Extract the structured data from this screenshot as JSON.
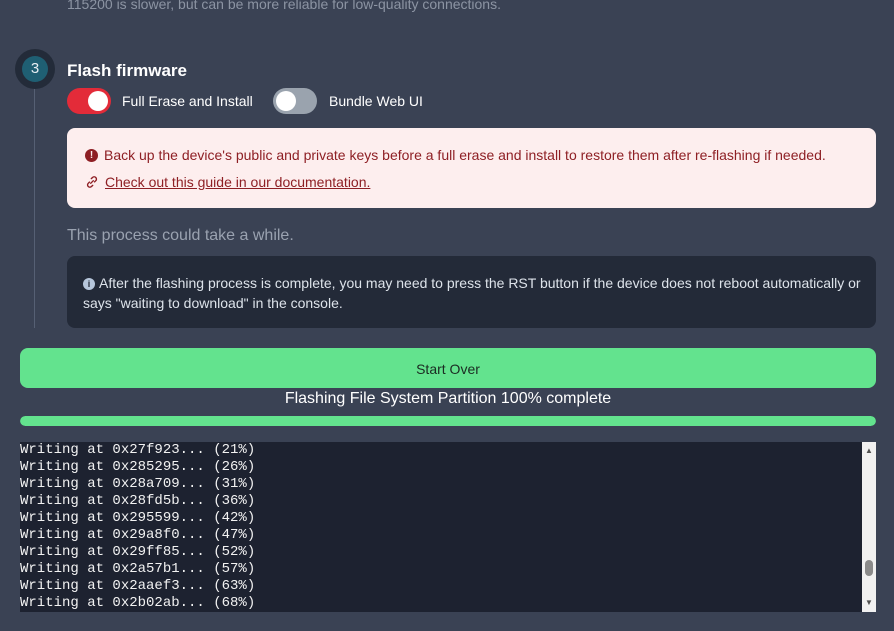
{
  "top_note": "115200 is slower, but can be more reliable for low-quality connections.",
  "step": {
    "number": "3",
    "title": "Flash firmware"
  },
  "toggles": [
    {
      "label": "Full Erase and Install",
      "state": "on"
    },
    {
      "label": "Bundle Web UI",
      "state": "off"
    }
  ],
  "warning": {
    "icon": "exclamation-icon",
    "text": "Back up the device's public and private keys before a full erase and install to restore them after re-flashing if needed.",
    "link_icon": "link-icon",
    "link_text": "Check out this guide in our documentation."
  },
  "process_note": "This process could take a while.",
  "info": {
    "icon": "info-icon",
    "text": "After the flashing process is complete, you may need to press the RST button if the device does not reboot automatically or says \"waiting to download\" in the console."
  },
  "start_over_label": "Start Over",
  "progress": {
    "label": "Flashing File System Partition 100% complete",
    "percent": 100
  },
  "console": {
    "lines": [
      "Writing at 0x27f923... (21%)",
      "Writing at 0x285295... (26%)",
      "Writing at 0x28a709... (31%)",
      "Writing at 0x28fd5b... (36%)",
      "Writing at 0x295599... (42%)",
      "Writing at 0x29a8f0... (47%)",
      "Writing at 0x29ff85... (52%)",
      "Writing at 0x2a57b1... (57%)",
      "Writing at 0x2aaef3... (63%)",
      "Writing at 0x2b02ab... (68%)"
    ]
  },
  "colors": {
    "accent_green": "#63e38e",
    "toggle_on": "#e32b39",
    "warning_text": "#8e1f24",
    "warning_bg": "#fdeeee"
  }
}
